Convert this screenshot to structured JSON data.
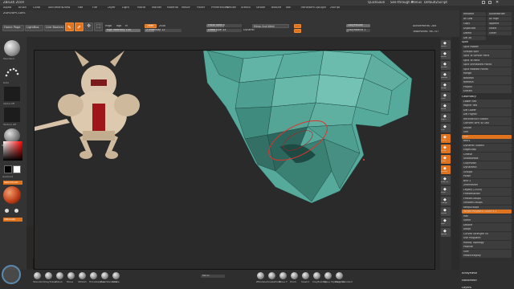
{
  "titlebar": {
    "app": "ZBrush 2019",
    "right_items": [
      "QuickSave",
      "See-through 0",
      "Menus",
      "DefaultZScript"
    ]
  },
  "menu": [
    "Alpha",
    "Brush",
    "Color",
    "Document",
    "Draw",
    "Edit",
    "File",
    "Layer",
    "Light",
    "Macro",
    "Marker",
    "Material",
    "Movie",
    "Picker",
    "Preferences",
    "Render",
    "Stencil",
    "Stroke",
    "Texture",
    "Tool",
    "Transform",
    "Zplugin",
    "Zscript"
  ],
  "shelf": {
    "lightbox_label": "LightBox",
    "home_label": "Home Page",
    "tool_label": "Live Boolean",
    "group_title": "ZGROUPS LAYS",
    "draw_label": "Edit",
    "move_label": "Draw",
    "mrgb": "Mrgb",
    "rgb": "Rgb",
    "m": "M",
    "zadd": "Zadd",
    "zsub": "Zsub",
    "rgb_intensity": "Rgb Intensity 100",
    "z_intensity": "Z Intensity 12",
    "focal_shift": "Focal Shift 0",
    "draw_size": "Draw Size 33",
    "dynamic": "Dynamic",
    "mirror": "Mirror And Weld",
    "active_points": "ActivePoints: 284",
    "total_points": "TotalPoints: 96.707",
    "lazymouse": "LazyMouse",
    "lazy_radius": "LazyRadius 1",
    "xyz": "XYZ"
  },
  "right_panel": {
    "top_buttons": [
      "Rename",
      "AutoReorder",
      "All Low",
      "All High",
      "Copy",
      "Append",
      "Duplicate",
      "Insert",
      "Delete",
      "Other",
      "Del All"
    ],
    "split_header": "Split",
    "split_items": [
      "Split Hidden",
      "Groups Split",
      "Split To Similar Parts",
      "Split To Parts",
      "Split Unmasked Points",
      "Split Masked Points"
    ],
    "merge_items": [
      "Merge",
      "Boolean",
      "Remesh",
      "Project",
      "Extract"
    ],
    "geometry_header": "Geometry",
    "geometry_items": [
      "Lower Res",
      "Higher Res",
      "Del Lower",
      "Del Higher",
      "Reconstruct Subdiv",
      "Convert BPR To Geo",
      "Divide",
      "Smt",
      "Suv",
      "ReUV",
      "Dynamic Subdiv",
      "EdgeLoop",
      "Crease",
      "ShadowBox",
      "ClayPolish",
      "DynaMesh",
      "Groups",
      "Polish",
      "Blur 2",
      "ZRemesher",
      "Legacy (2018)",
      "FreezeBorder",
      "FreezeGroups",
      "SmoothGroups",
      "KeepGroups",
      "Target Polygons Count 4.1",
      "Half",
      "Same",
      "Double",
      "Adapt",
      "Curves Strength 50",
      "Use Polypaint",
      "Modify Topology",
      "Position",
      "Size",
      "MeshIntegrity"
    ],
    "bottom_items": [
      "ArrayMesh",
      "NanoMesh",
      "Layers"
    ]
  },
  "right_strip": [
    "Scroll",
    "Zoom",
    "Actual",
    "AAHalf",
    "Persp",
    "Floor",
    "Local",
    "LSym",
    "XYZ",
    "Frame",
    "Move",
    "Scale",
    "Rotate",
    "Line Fill",
    "PolyF",
    "Transp",
    "Ghost",
    "Solo",
    "Xpose"
  ],
  "left_tray": {
    "labels": [
      "Standard",
      "Dots",
      "Alpha Off",
      "Texture Off",
      "BasicMaterial"
    ],
    "gradient": "Gradient",
    "switch_color": "SwitchColor",
    "alternate": "Alternate"
  },
  "bottom_brushes": [
    "Standard",
    "ClayTubes",
    "Polish",
    "Move",
    "hPolish",
    "TrimAdaptive",
    "DamStandard",
    "Inflate",
    "ZModeler",
    "SnakeHook",
    "Move T",
    "Pinch",
    "Slash3",
    "ClayBuildup",
    "Move Topological",
    "Dam Standard"
  ],
  "bottom_mid_label": "Mirror",
  "colors": {
    "mesh": "#4fa697",
    "mesh_dark": "#2f6b61",
    "orange": "#e0731e",
    "bg": "#2b2b2b"
  }
}
